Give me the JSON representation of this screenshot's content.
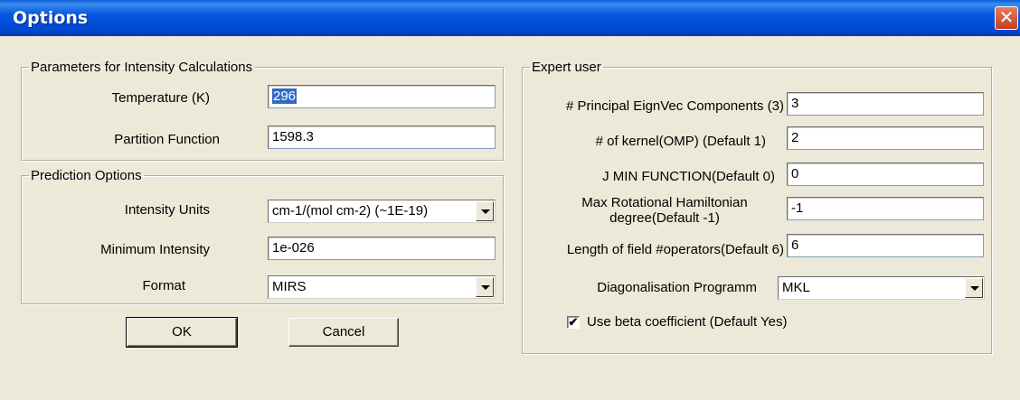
{
  "window": {
    "title": "Options",
    "close_glyph": "✕"
  },
  "intensity_params": {
    "legend": "Parameters for Intensity Calculations",
    "temperature_label": "Temperature (K)",
    "temperature_value": "296",
    "partition_label": "Partition Function",
    "partition_value": "1598.3"
  },
  "prediction": {
    "legend": "Prediction Options",
    "units_label": "Intensity Units",
    "units_value": "cm-1/(mol cm-2) (~1E-19)",
    "min_label": "Minimum Intensity",
    "min_value": "1e-026",
    "format_label": "Format",
    "format_value": "MIRS"
  },
  "buttons": {
    "ok": "OK",
    "cancel": "Cancel"
  },
  "expert": {
    "legend": "Expert user",
    "eignvec_label": "# Principal EignVec Components (3)",
    "eignvec_value": "3",
    "kernel_label": "# of kernel(OMP) (Default 1)",
    "kernel_value": "2",
    "jmin_label": "J MIN FUNCTION(Default 0)",
    "jmin_value": "0",
    "maxrot_label": "Max Rotational Hamiltonian degree(Default -1)",
    "maxrot_value": "-1",
    "length_label": "Length of field #operators(Default 6)",
    "length_value": "6",
    "diag_label": "Diagonalisation Programm",
    "diag_value": "MKL",
    "beta_label": "Use beta coefficient (Default Yes)",
    "beta_checked": true,
    "check_glyph": "✔"
  }
}
